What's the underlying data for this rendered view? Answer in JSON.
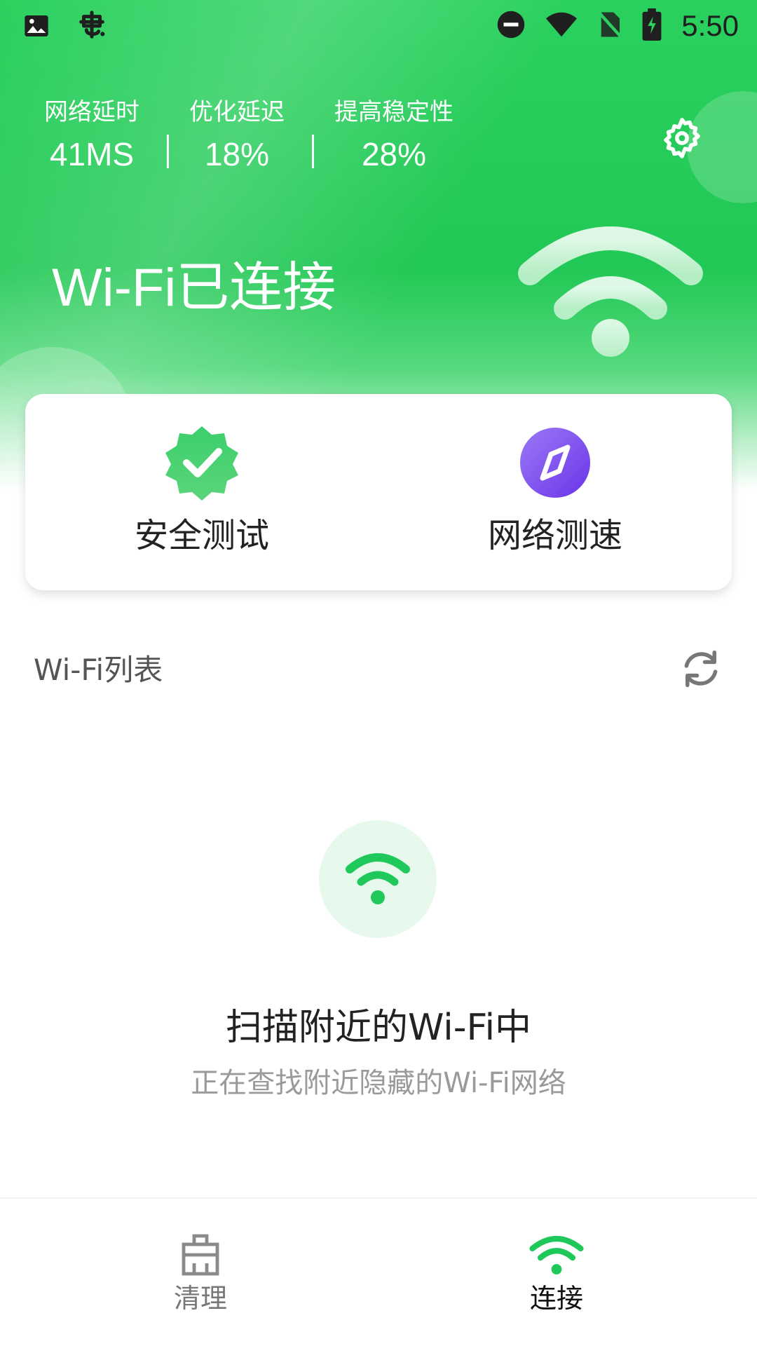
{
  "status_bar": {
    "time": "5:50",
    "icons": [
      "image-icon",
      "app-bug-icon",
      "do-not-disturb-icon",
      "wifi-signal-icon",
      "no-sim-icon",
      "battery-charging-icon"
    ]
  },
  "stats": [
    {
      "label": "网络延时",
      "value": "41MS"
    },
    {
      "label": "优化延迟",
      "value": "18%"
    },
    {
      "label": "提高稳定性",
      "value": "28%"
    }
  ],
  "hero": {
    "title": "Wi-Fi已连接"
  },
  "actions": [
    {
      "label": "安全测试",
      "icon": "shield-check-icon"
    },
    {
      "label": "网络测速",
      "icon": "compass-icon"
    }
  ],
  "wifi_list": {
    "title": "Wi-Fi列表"
  },
  "scanning": {
    "title": "扫描附近的Wi-Fi中",
    "subtitle": "正在查找附近隐藏的Wi-Fi网络"
  },
  "bottom_nav": [
    {
      "label": "清理",
      "icon": "broom-icon",
      "active": false
    },
    {
      "label": "连接",
      "icon": "wifi-icon",
      "active": true
    }
  ],
  "colors": {
    "brand_green": "#22c855",
    "action_purple": "#7b4cf0",
    "scan_bg": "#e7f8ec"
  }
}
